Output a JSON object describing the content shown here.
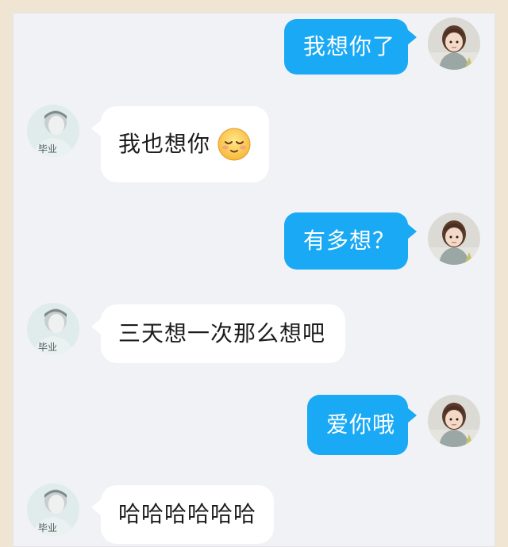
{
  "colors": {
    "sent_bubble": "#1aa9f4",
    "received_bubble": "#ffffff",
    "chat_background": "#f1f2f6",
    "frame": "#f0e5d3"
  },
  "conversation": {
    "messages": [
      {
        "sender": "me",
        "text": "我想你了",
        "avatar_icon": "girl-avatar-icon"
      },
      {
        "sender": "other",
        "text": "我也想你",
        "avatar_icon": "boy-avatar-icon",
        "emoji": "shy-smile-emoji-icon"
      },
      {
        "sender": "me",
        "text": "有多想？",
        "avatar_icon": "girl-avatar-icon"
      },
      {
        "sender": "other",
        "text": "三天想一次那么想吧",
        "avatar_icon": "boy-avatar-icon"
      },
      {
        "sender": "me",
        "text": "爱你哦",
        "avatar_icon": "girl-avatar-icon"
      },
      {
        "sender": "other",
        "text": "哈哈哈哈哈哈",
        "avatar_icon": "boy-avatar-icon"
      }
    ]
  }
}
